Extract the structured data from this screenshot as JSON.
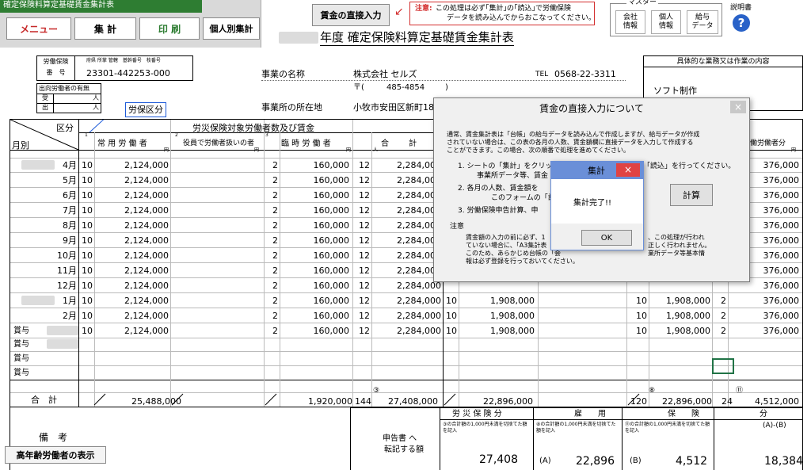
{
  "app": {
    "title": "確定保険料算定基礎賃金集計表",
    "menu_label": "メニュー",
    "total_label": "集 計",
    "print_label": "印 刷",
    "individual_label": "個人別集計"
  },
  "top": {
    "direct_input_label": "賃金の直接入力",
    "notice_head": "注意:",
    "notice_line1": "この処理は必ず｢集計｣の｢読込｣で労働保険",
    "notice_line2": "データを読み込んでからおこなってください。",
    "master_label": "マスター",
    "master_buttons": [
      "会社\n情報",
      "個人\n情報",
      "給与\nデータ"
    ],
    "manual_label": "説明書",
    "page_title_suffix": "年度 確定保険料算定基礎賃金集計表"
  },
  "info": {
    "insurance_no_label": "労働保険\n番　号",
    "insurance_no_sub": "府県 所掌 管轄　基幹番号　枝番号",
    "insurance_no": "23301-442253-000",
    "temp_workers_label": "出向労働者の有無",
    "receive_label": "受",
    "send_label": "出",
    "person_unit": "人",
    "category_label": "労保区分",
    "business_name_label": "事業の名称",
    "business_name": "株式会社 セルズ",
    "tel_label": "TEL",
    "tel": "0568-22-3311",
    "postal_mark": "〒(",
    "postal": "485-4854",
    "postal_close": ")",
    "address_label": "事業所の所在地",
    "address": "小牧市安田区新町18",
    "work_content_label": "具体的な業務又は作業の内容",
    "work_content": "ソフト制作"
  },
  "table": {
    "category_header": "区分",
    "month_header": "月別",
    "labor_group_header": "労災保険対象労働者数及び賃金",
    "col_regular": "常 用 労 働 者",
    "col_officer": "役員で労働者扱いの者",
    "col_temp": "臨 時 労 働 者",
    "col_sum": "合 計",
    "col_partial": "働労働者分",
    "col_no1": "1",
    "col_no2": "2",
    "col_no3": "3",
    "yen": "円",
    "people": "人",
    "rows": [
      {
        "month": "4月",
        "reg_n": "10",
        "reg_amt": "2,124,000",
        "tmp_n": "2",
        "tmp_amt": "160,000",
        "sum_n": "12",
        "sum_amt": "2,284,000",
        "r_n1": "",
        "r_amt1": "",
        "r_n2": "",
        "r_amt2": "",
        "r_n3": "",
        "r_amt3": "376,000"
      },
      {
        "month": "5月",
        "reg_n": "10",
        "reg_amt": "2,124,000",
        "tmp_n": "2",
        "tmp_amt": "160,000",
        "sum_n": "12",
        "sum_amt": "2,284,000",
        "r_n1": "",
        "r_amt1": "",
        "r_n2": "",
        "r_amt2": "",
        "r_n3": "",
        "r_amt3": "376,000"
      },
      {
        "month": "6月",
        "reg_n": "10",
        "reg_amt": "2,124,000",
        "tmp_n": "2",
        "tmp_amt": "160,000",
        "sum_n": "12",
        "sum_amt": "2,284,000",
        "r_n1": "",
        "r_amt1": "",
        "r_n2": "",
        "r_amt2": "",
        "r_n3": "",
        "r_amt3": "376,000"
      },
      {
        "month": "7月",
        "reg_n": "10",
        "reg_amt": "2,124,000",
        "tmp_n": "2",
        "tmp_amt": "160,000",
        "sum_n": "12",
        "sum_amt": "2,284,000",
        "r_n1": "",
        "r_amt1": "",
        "r_n2": "",
        "r_amt2": "",
        "r_n3": "",
        "r_amt3": "376,000"
      },
      {
        "month": "8月",
        "reg_n": "10",
        "reg_amt": "2,124,000",
        "tmp_n": "2",
        "tmp_amt": "160,000",
        "sum_n": "12",
        "sum_amt": "2,284,000",
        "r_n1": "",
        "r_amt1": "",
        "r_n2": "",
        "r_amt2": "",
        "r_n3": "",
        "r_amt3": "376,000"
      },
      {
        "month": "9月",
        "reg_n": "10",
        "reg_amt": "2,124,000",
        "tmp_n": "2",
        "tmp_amt": "160,000",
        "sum_n": "12",
        "sum_amt": "2,284,000",
        "r_n1": "",
        "r_amt1": "",
        "r_n2": "",
        "r_amt2": "",
        "r_n3": "",
        "r_amt3": "376,000"
      },
      {
        "month": "10月",
        "reg_n": "10",
        "reg_amt": "2,124,000",
        "tmp_n": "2",
        "tmp_amt": "160,000",
        "sum_n": "12",
        "sum_amt": "2,284,000",
        "r_n1": "",
        "r_amt1": "",
        "r_n2": "",
        "r_amt2": "",
        "r_n3": "",
        "r_amt3": "376,000"
      },
      {
        "month": "11月",
        "reg_n": "10",
        "reg_amt": "2,124,000",
        "tmp_n": "2",
        "tmp_amt": "160,000",
        "sum_n": "12",
        "sum_amt": "2,284,000",
        "r_n1": "",
        "r_amt1": "",
        "r_n2": "",
        "r_amt2": "",
        "r_n3": "",
        "r_amt3": "376,000"
      },
      {
        "month": "12月",
        "reg_n": "10",
        "reg_amt": "2,124,000",
        "tmp_n": "2",
        "tmp_amt": "160,000",
        "sum_n": "12",
        "sum_amt": "2,284,000",
        "r_n1": "",
        "r_amt1": "",
        "r_n2": "",
        "r_amt2": "",
        "r_n3": "",
        "r_amt3": "376,000"
      },
      {
        "month": "1月",
        "reg_n": "10",
        "reg_amt": "2,124,000",
        "tmp_n": "2",
        "tmp_amt": "160,000",
        "sum_n": "12",
        "sum_amt": "2,284,000",
        "r_n1": "10",
        "r_amt1": "1,908,000",
        "r_n2": "10",
        "r_amt2": "1,908,000",
        "r_n3": "2",
        "r_amt3": "376,000"
      },
      {
        "month": "2月",
        "reg_n": "10",
        "reg_amt": "2,124,000",
        "tmp_n": "2",
        "tmp_amt": "160,000",
        "sum_n": "12",
        "sum_amt": "2,284,000",
        "r_n1": "10",
        "r_amt1": "1,908,000",
        "r_n2": "10",
        "r_amt2": "1,908,000",
        "r_n3": "2",
        "r_amt3": "376,000"
      },
      {
        "month": "3月",
        "reg_n": "10",
        "reg_amt": "2,124,000",
        "tmp_n": "2",
        "tmp_amt": "160,000",
        "sum_n": "12",
        "sum_amt": "2,284,000",
        "r_n1": "10",
        "r_amt1": "1,908,000",
        "r_n2": "10",
        "r_amt2": "1,908,000",
        "r_n3": "2",
        "r_amt3": "376,000"
      }
    ],
    "bonus_label": "賞与",
    "total": {
      "label": "合　計",
      "reg_amt": "25,488,000",
      "tmp_amt": "1,920,000",
      "sum_n": "144",
      "mark3": "③",
      "sum_amt": "27,408,000",
      "r_amt1": "22,896,000",
      "r_n2": "120",
      "mark8": "⑧",
      "r_amt2": "22,896,000",
      "r_n3": "24",
      "mark11": "⑪",
      "r_amt3": "4,512,000"
    }
  },
  "summary": {
    "remarks_label": "備　考",
    "elderly_button": "高年齢労働者の表示",
    "transfer_label_1": "申告書 へ",
    "transfer_label_2": "転記する額",
    "rousai_header": "労 災 保 険 分",
    "koyou_header": "雇　　用",
    "hoken_header": "保　　険",
    "bun_header": "分",
    "ab_header": "(A)-(B)",
    "note1": "③の合計額の1,000円未満を切捨てた額を記入",
    "note2": "⑧の合計額の1,000円未満を切捨てた額を記入",
    "note3": "⑪の合計額の1,000円未満を切捨てた額を記入",
    "rousai_value": "27,408",
    "a_label": "(A)",
    "koyou_value": "22,896",
    "b_label": "(B)",
    "b_value": "4,512",
    "ab_value": "18,384"
  },
  "dialog_direct": {
    "title": "賃金の直接入力について",
    "close": "×",
    "intro1": "通常、賃金集計表は「台帳」の給与データを読み込んで作成しますが、給与データが作成",
    "intro2": "されていない場合は、この表の各月の人数、賃金額欄に直接データを入力して作成する",
    "intro3": "ことができます。この場合、次の順番で処理を進めてください。",
    "step1": "1.  シートの「集計」をクリック、",
    "step1b": "「読込」を行ってください。",
    "step1c": "事業所データ等、賃金",
    "step2": "2.   各月の人数、賃金額を",
    "step2b": "このフォームの「計算",
    "step3": "3.   労働保険申告計算、申",
    "calc_button": "計算",
    "note_head": "注意",
    "note1": "賃金額の入力の前に必ず、1",
    "note1b": "、この処理が行われ",
    "note2": "ていない場合に、｢A3集計表",
    "note2b": "正しく行われません。",
    "note3": "このため、あらかじめ台帳の「会",
    "note3b": "業所データ等基本情",
    "note4": "報は必ず登録を行っておいてください。"
  },
  "dialog_msg": {
    "title": "集計",
    "close": "×",
    "message": "集計完了!!",
    "ok": "OK"
  },
  "colors": {
    "title_bar": "#2e7d32",
    "menu_text": "#c62828",
    "print_text": "#2e7d32",
    "notice": "#d32f2f",
    "category_box": "#1e5bd8",
    "close_red": "#e04343",
    "msg_border": "#6a8fd8"
  }
}
